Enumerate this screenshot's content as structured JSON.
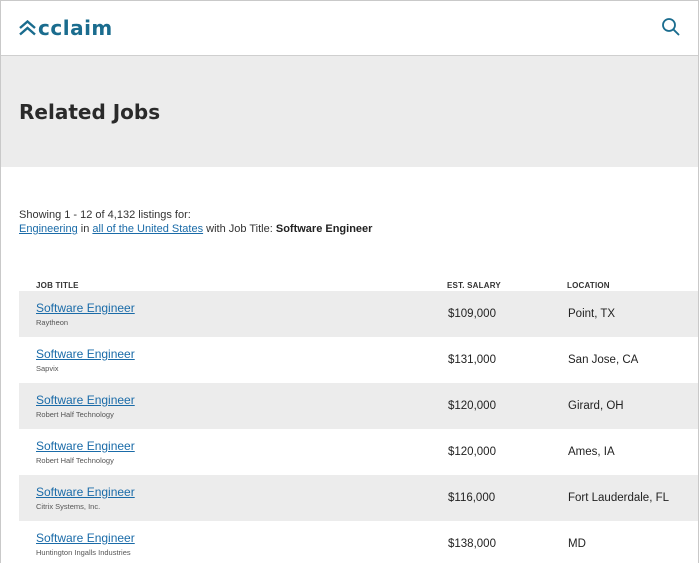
{
  "header": {
    "logo_text": "cclaim",
    "brand_color": "#1a6c8e",
    "search_icon": "search-icon"
  },
  "hero": {
    "title": "Related Jobs"
  },
  "summary": {
    "showing_text": "Showing 1 - 12 of 4,132 listings for:",
    "category_link": "Engineering",
    "in_text": " in ",
    "location_link": "all of the United States",
    "with_text": " with Job Title: ",
    "job_title_filter": "Software Engineer"
  },
  "table": {
    "headers": {
      "job_title": "JOB TITLE",
      "salary": "EST. SALARY",
      "location": "LOCATION"
    },
    "rows": [
      {
        "title": "Software Engineer",
        "company": "Raytheon",
        "salary": "$109,000",
        "location": "Point, TX"
      },
      {
        "title": "Software Engineer",
        "company": "Sapvix",
        "salary": "$131,000",
        "location": "San Jose, CA"
      },
      {
        "title": "Software Engineer",
        "company": "Robert Half Technology",
        "salary": "$120,000",
        "location": "Girard, OH"
      },
      {
        "title": "Software Engineer",
        "company": "Robert Half Technology",
        "salary": "$120,000",
        "location": "Ames, IA"
      },
      {
        "title": "Software Engineer",
        "company": "Citrix Systems, Inc.",
        "salary": "$116,000",
        "location": "Fort Lauderdale, FL"
      },
      {
        "title": "Software Engineer",
        "company": "Huntington Ingalls Industries",
        "salary": "$138,000",
        "location": "MD"
      }
    ]
  }
}
